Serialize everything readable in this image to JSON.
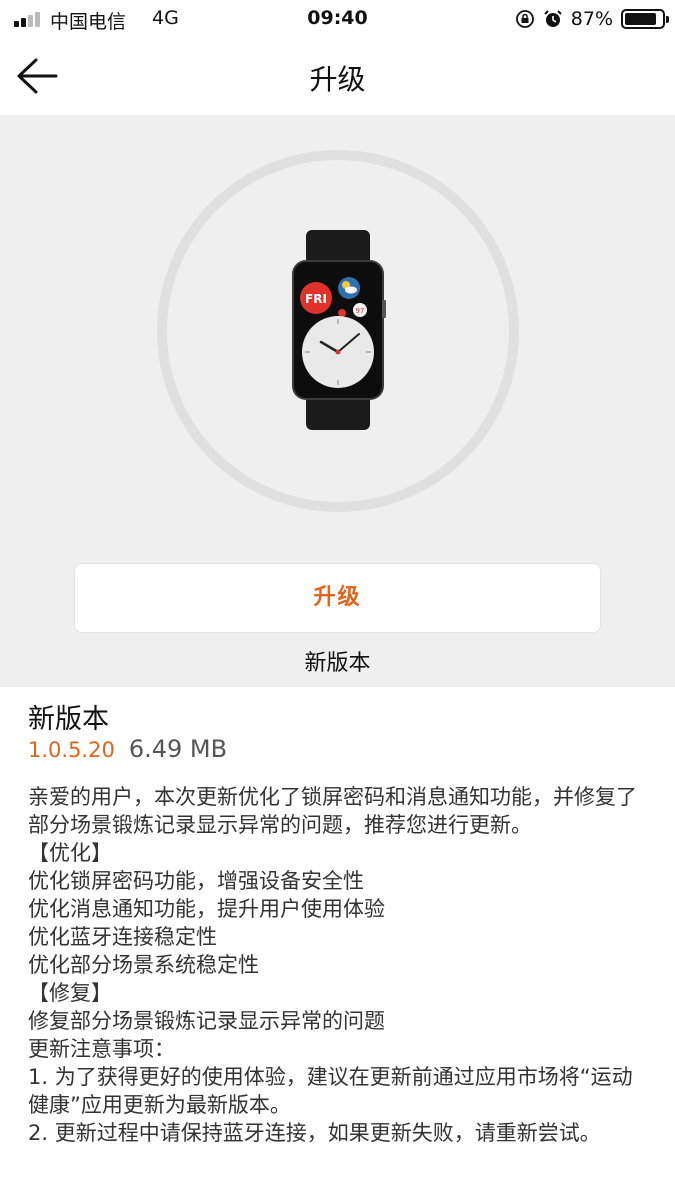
{
  "status_bar": {
    "carrier": "中国电信",
    "network": "4G",
    "time": "09:40",
    "battery_percent_text": "87%",
    "battery_level": 0.87,
    "icons": [
      "signal-icon",
      "orientation-lock-icon",
      "alarm-icon",
      "battery-icon"
    ]
  },
  "nav": {
    "title": "升级",
    "back_icon": "back-arrow-icon"
  },
  "hero": {
    "image": "smartwatch-image",
    "watch_face": {
      "day": "FRI",
      "badge": "97"
    },
    "upgrade_button_label": "升级",
    "caption": "新版本"
  },
  "details": {
    "title": "新版本",
    "version": "1.0.5.20",
    "size": "6.49 MB",
    "notes": [
      "亲爱的用户，本次更新优化了锁屏密码和消息通知功能，并修复了部分场景锻炼记录显示异常的问题，推荐您进行更新。",
      "【优化】",
      "优化锁屏密码功能，增强设备安全性",
      "优化消息通知功能，提升用户使用体验",
      "优化蓝牙连接稳定性",
      "优化部分场景系统稳定性",
      "【修复】",
      "修复部分场景锻炼记录显示异常的问题",
      "更新注意事项：",
      "1. 为了获得更好的使用体验，建议在更新前通过应用市场将“运动健康”应用更新为最新版本。",
      "2. 更新过程中请保持蓝牙连接，如果更新失败，请重新尝试。"
    ]
  },
  "colors": {
    "accent": "#e2641a",
    "background": "#efefef"
  }
}
